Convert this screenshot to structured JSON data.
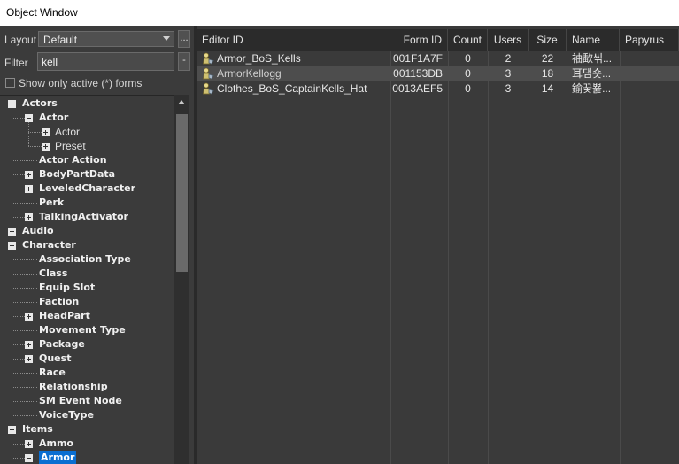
{
  "window": {
    "title": "Object Window"
  },
  "controls": {
    "layout_label": "Layout",
    "layout_value": "Default",
    "filter_label": "Filter",
    "filter_value": "kell",
    "show_active_label": "Show only active (*) forms",
    "ellipsis": "...",
    "minus": "-"
  },
  "tree": [
    {
      "label": "Actors",
      "level": 0,
      "expander": "minus",
      "bold": true
    },
    {
      "label": "Actor",
      "level": 1,
      "expander": "minus",
      "bold": true
    },
    {
      "label": "Actor",
      "level": 2,
      "expander": "plus",
      "bold": false
    },
    {
      "label": "Preset",
      "level": 2,
      "expander": "plus",
      "bold": false
    },
    {
      "label": "Actor Action",
      "level": 1,
      "expander": "none",
      "bold": true
    },
    {
      "label": "BodyPartData",
      "level": 1,
      "expander": "plus",
      "bold": true
    },
    {
      "label": "LeveledCharacter",
      "level": 1,
      "expander": "plus",
      "bold": true
    },
    {
      "label": "Perk",
      "level": 1,
      "expander": "none",
      "bold": true
    },
    {
      "label": "TalkingActivator",
      "level": 1,
      "expander": "plus",
      "bold": true
    },
    {
      "label": "Audio",
      "level": 0,
      "expander": "plus",
      "bold": true
    },
    {
      "label": "Character",
      "level": 0,
      "expander": "minus",
      "bold": true
    },
    {
      "label": "Association Type",
      "level": 1,
      "expander": "none",
      "bold": true
    },
    {
      "label": "Class",
      "level": 1,
      "expander": "none",
      "bold": true
    },
    {
      "label": "Equip Slot",
      "level": 1,
      "expander": "none",
      "bold": true
    },
    {
      "label": "Faction",
      "level": 1,
      "expander": "none",
      "bold": true
    },
    {
      "label": "HeadPart",
      "level": 1,
      "expander": "plus",
      "bold": true
    },
    {
      "label": "Movement Type",
      "level": 1,
      "expander": "none",
      "bold": true
    },
    {
      "label": "Package",
      "level": 1,
      "expander": "plus",
      "bold": true
    },
    {
      "label": "Quest",
      "level": 1,
      "expander": "plus",
      "bold": true
    },
    {
      "label": "Race",
      "level": 1,
      "expander": "none",
      "bold": true
    },
    {
      "label": "Relationship",
      "level": 1,
      "expander": "none",
      "bold": true
    },
    {
      "label": "SM Event Node",
      "level": 1,
      "expander": "none",
      "bold": true
    },
    {
      "label": "VoiceType",
      "level": 1,
      "expander": "none",
      "bold": true
    },
    {
      "label": "Items",
      "level": 0,
      "expander": "minus",
      "bold": true
    },
    {
      "label": "Ammo",
      "level": 1,
      "expander": "plus",
      "bold": true
    },
    {
      "label": "Armor",
      "level": 1,
      "expander": "minus",
      "bold": true,
      "selected": true
    }
  ],
  "grid": {
    "columns": [
      "Editor ID",
      "Form ID",
      "Count",
      "Users",
      "Size",
      "Name",
      "Papyrus"
    ],
    "rows": [
      {
        "editor_id": "Armor_BoS_Kells",
        "form_id": "001F1A7F",
        "count": "0",
        "users": "2",
        "size": "22",
        "name": "袖歃씪...",
        "papyrus": ""
      },
      {
        "editor_id": "ArmorKellogg",
        "form_id": "001153DB",
        "count": "0",
        "users": "3",
        "size": "18",
        "name": "耳댐숏...",
        "papyrus": ""
      },
      {
        "editor_id": "Clothes_BoS_CaptainKells_Hat",
        "form_id": "0013AEF5",
        "count": "0",
        "users": "3",
        "size": "14",
        "name": "鍮꿎뾽...",
        "papyrus": ""
      }
    ]
  }
}
